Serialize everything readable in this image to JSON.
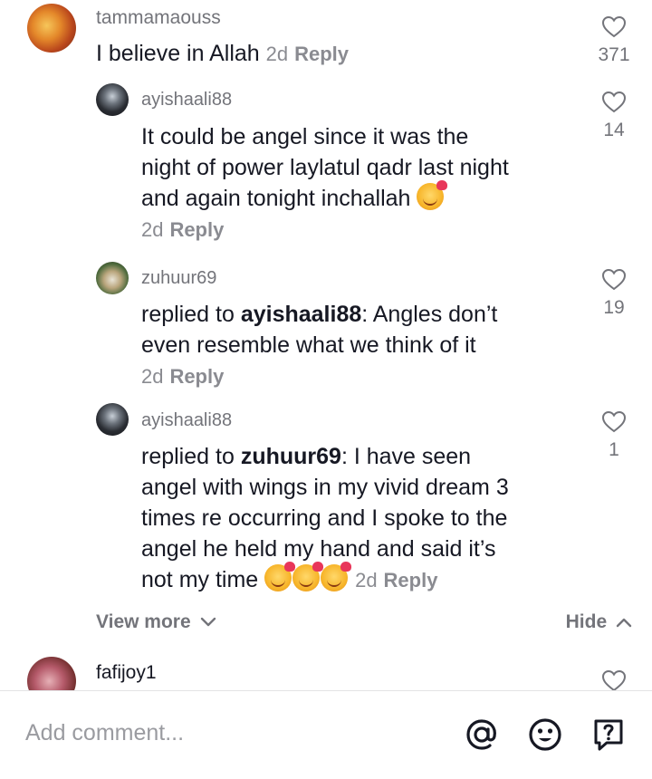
{
  "comments": [
    {
      "username": "tammamaouss",
      "text": "I believe in Allah",
      "time": "2d",
      "reply_label": "Reply",
      "likes": "371"
    },
    {
      "username": "ayishaali88",
      "line1": "It could be angel since it was the",
      "line2": "night of power laylatul qadr last night",
      "line3": "and again tonight inchallah",
      "time": "2d",
      "reply_label": "Reply",
      "likes": "14"
    },
    {
      "username": "zuhuur69",
      "replied_prefix": "replied to",
      "replied_user": "ayishaali88",
      "text_a": ": Angles don’t",
      "text_b": "even resemble what we think of it",
      "time": "2d",
      "reply_label": "Reply",
      "likes": "19"
    },
    {
      "username": "ayishaali88",
      "replied_prefix": "replied to",
      "replied_user": "zuhuur69",
      "text_a": ": I have seen",
      "text_b": "angel with wings in my vivid dream 3",
      "text_c": "times re occurring and I spoke to the",
      "text_d": "angel he held my hand and said it’s",
      "text_e": "not my time",
      "time": "2d",
      "reply_label": "Reply",
      "likes": "1"
    },
    {
      "username": "fafijoy1"
    }
  ],
  "view_more_label": "View more",
  "hide_label": "Hide",
  "add_comment_placeholder": "Add comment...",
  "icons": [
    "heart-icon",
    "chevron-down-icon",
    "chevron-up-icon",
    "at-mention-icon",
    "emoji-icon",
    "question-icon"
  ]
}
